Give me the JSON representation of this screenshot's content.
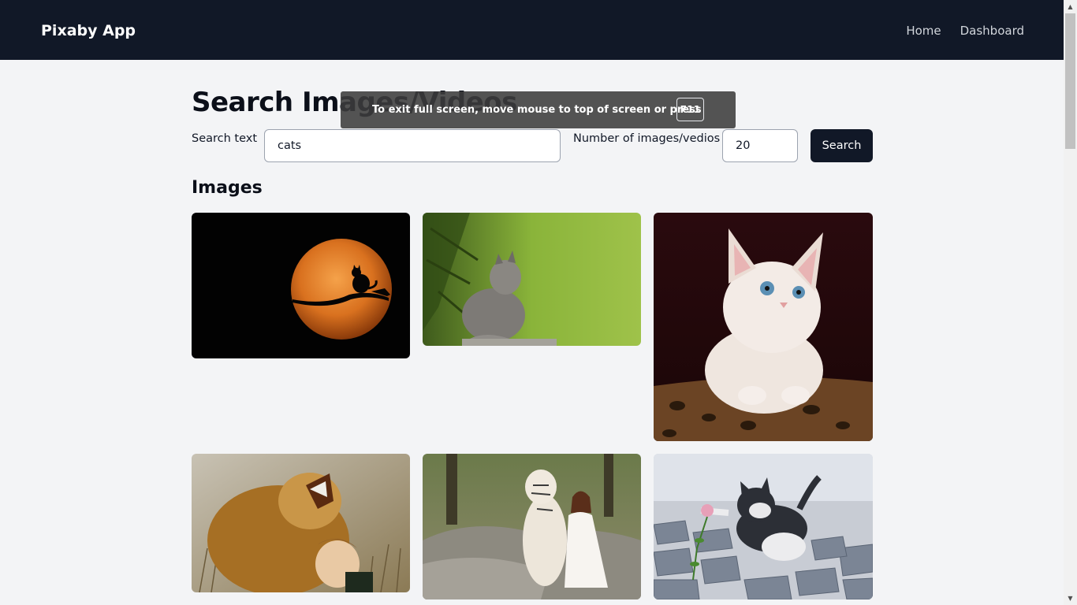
{
  "nav": {
    "brand": "Pixaby App",
    "links": [
      "Home",
      "Dashboard"
    ]
  },
  "main": {
    "title": "Search Images/Videos",
    "search_label": "Search text",
    "search_value": "cats",
    "count_label": "Number of images/vedios",
    "count_value": "20",
    "search_button": "Search",
    "section_title": "Images"
  },
  "fullscreen_notice": {
    "text": "To exit full screen, move mouse to top of screen or press",
    "key": "F11"
  },
  "images": [
    {
      "subject": "cat silhouette on branch against orange full moon"
    },
    {
      "subject": "grey kitten sitting in green grass"
    },
    {
      "subject": "white kitten with blue eyes on leopard print blanket"
    },
    {
      "subject": "lion roaring while hugging a smiling girl"
    },
    {
      "subject": "white tiger sitting beside woman in white dress on rocks"
    },
    {
      "subject": "black and white kitten reaching for pink flower on cobblestones"
    }
  ],
  "colors": {
    "navbar": "#111827",
    "page_bg": "#f3f4f6",
    "button": "#111827"
  }
}
